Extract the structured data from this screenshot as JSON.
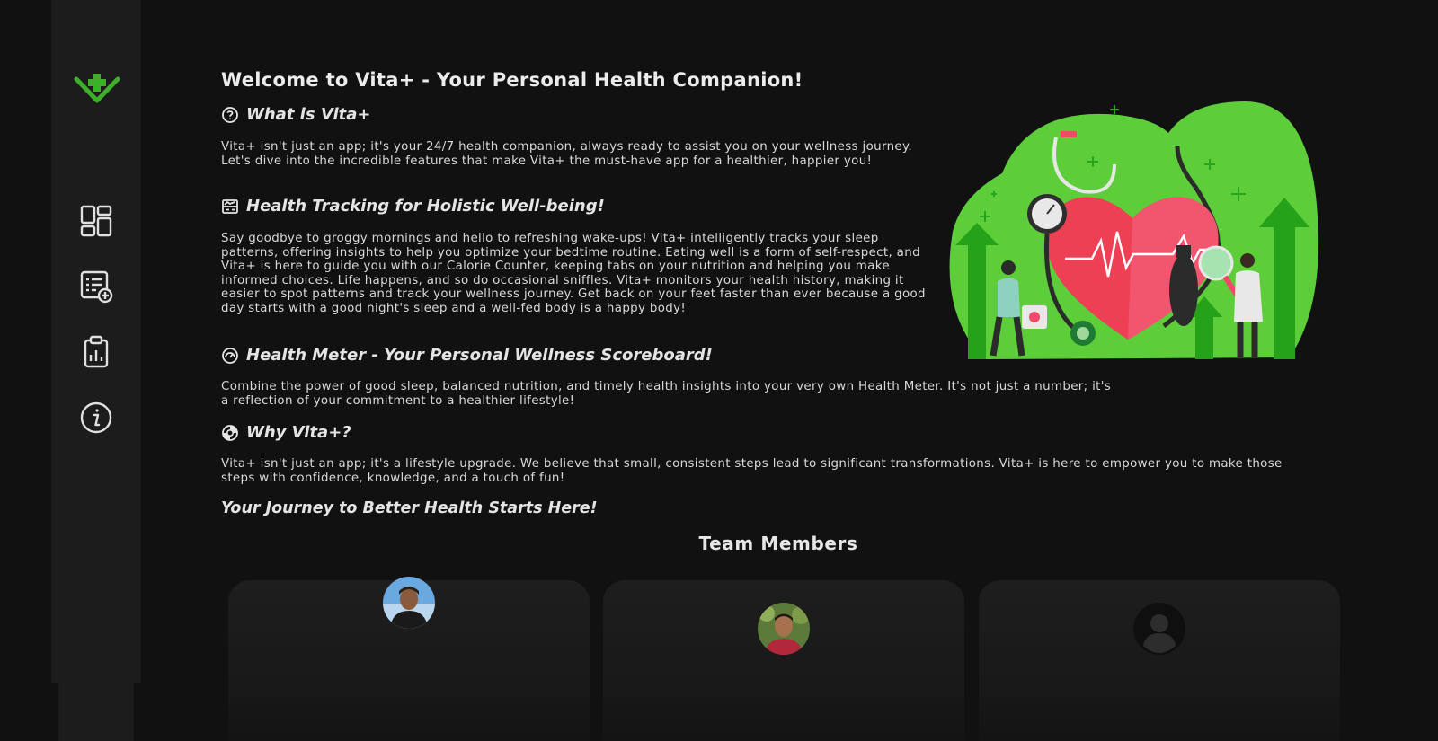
{
  "app": {
    "name": "Vita+",
    "accent_color": "#3fae2a"
  },
  "sidebar": {
    "logo": "vita-plus-logo-icon",
    "items": [
      {
        "icon": "dashboard-icon"
      },
      {
        "icon": "add-log-icon"
      },
      {
        "icon": "report-clipboard-icon"
      },
      {
        "icon": "info-icon"
      }
    ]
  },
  "main": {
    "title": "Welcome to Vita+ - Your Personal Health Companion!",
    "sections": [
      {
        "icon": "question-circle-icon",
        "heading": "What is Vita+",
        "text": "Vita+ isn't just an app; it's your 24/7 health companion, always ready to assist you on your wellness journey. Let's dive into the incredible features that make Vita+ the must-have app for a healthier, happier you!"
      },
      {
        "icon": "tracking-chart-icon",
        "heading": "Health Tracking for Holistic Well-being!",
        "text": "Say goodbye to groggy mornings and hello to refreshing wake-ups! Vita+ intelligently tracks your sleep patterns, offering insights to help you optimize your bedtime routine. Eating well is a form of self-respect, and Vita+ is here to guide you with our Calorie Counter, keeping tabs on your nutrition and helping you make informed choices. Life happens, and so do occasional sniffles. Vita+ monitors your health history, making it easier to spot patterns and track your wellness journey. Get back on your feet faster than ever because a good day starts with a good night's sleep and a well-fed body is a happy body!"
      },
      {
        "icon": "gauge-icon",
        "heading": "Health Meter - Your Personal Wellness Scoreboard!",
        "text": "Combine the power of good sleep, balanced nutrition, and timely health insights into your very own Health Meter. It's not just a number; it's a reflection of your commitment to a healthier lifestyle!"
      },
      {
        "icon": "lifebuoy-icon",
        "heading": "Why Vita+?",
        "text": "Vita+ isn't just an app; it's a lifestyle upgrade. We believe that small, consistent steps lead to significant transformations. Vita+ is here to empower you to make those steps with confidence, knowledge, and a touch of fun!"
      }
    ],
    "closing": "Your Journey to Better Health Starts Here!",
    "illustration": "health-heart-stethoscope-illustration"
  },
  "team": {
    "title": "Team Members",
    "members": [
      {
        "avatar": "member-photo-1"
      },
      {
        "avatar": "member-photo-2"
      },
      {
        "avatar": "default-user-avatar-icon"
      }
    ]
  }
}
